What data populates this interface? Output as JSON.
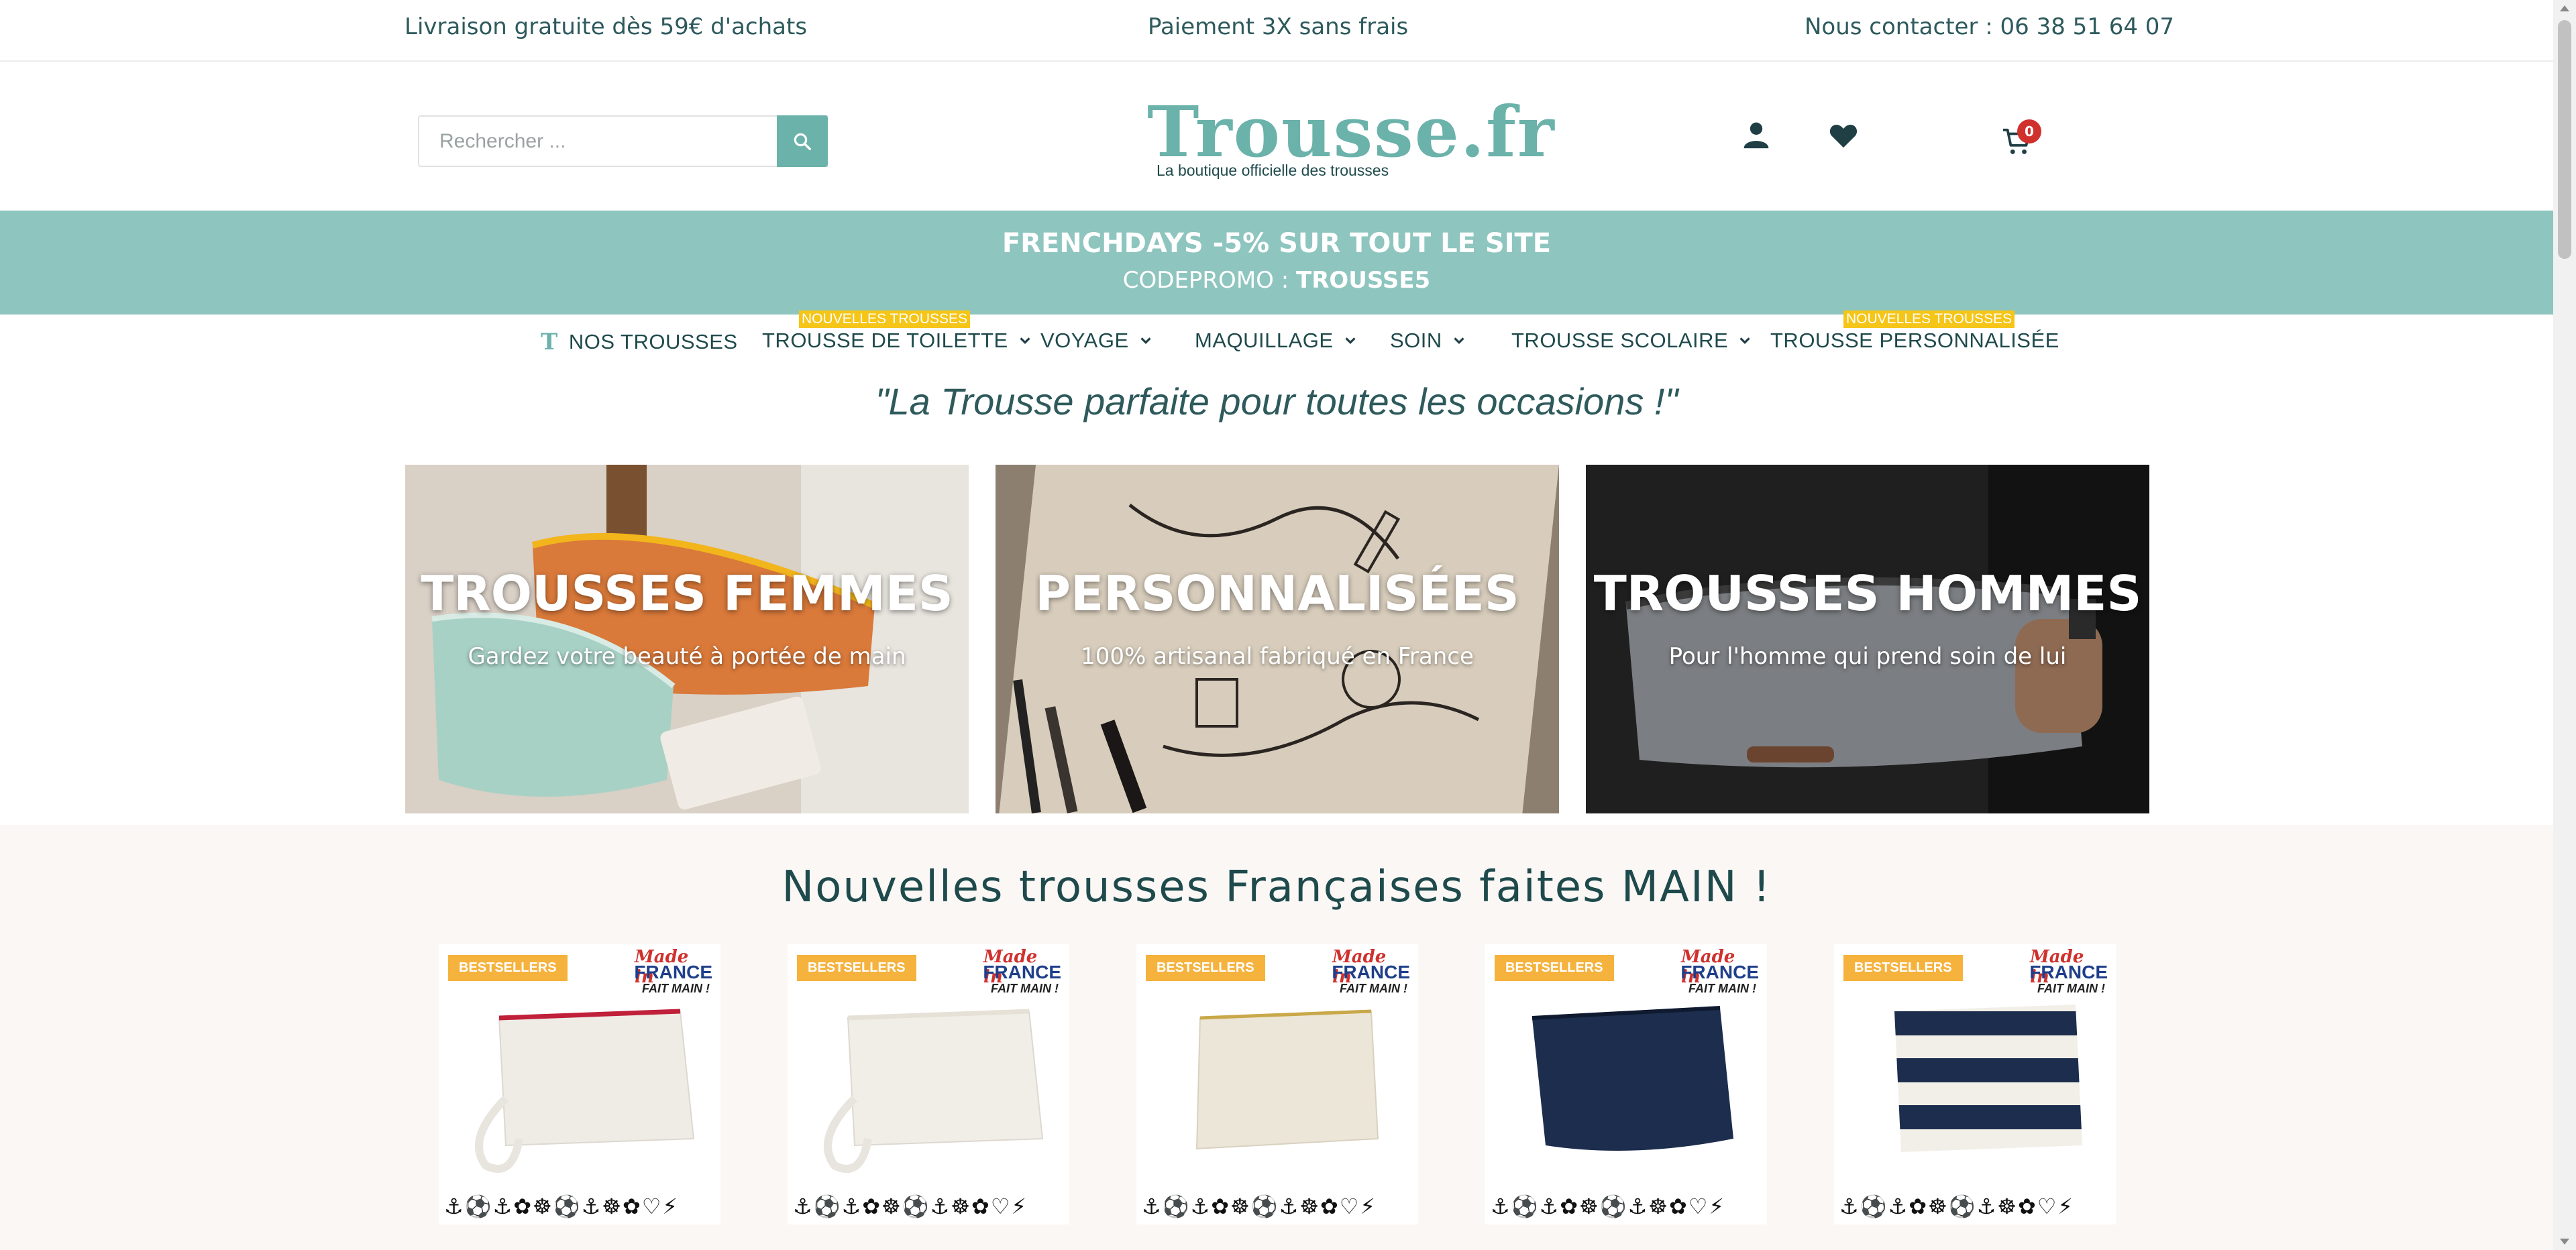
{
  "topbar": {
    "shipping": "Livraison gratuite dès 59€ d'achats",
    "payment": "Paiement 3X sans frais",
    "contact": "Nous contacter : 06 38 51 64 07"
  },
  "header": {
    "search_placeholder": "Rechercher ...",
    "logo_text": "Trousse.fr",
    "logo_tagline": "La boutique officielle des trousses",
    "cart_count": "0",
    "icons": [
      "search-icon",
      "user-icon",
      "heart-icon",
      "cart-icon"
    ]
  },
  "promo": {
    "line1": "FRENCHDAYS -5% SUR TOUT LE SITE",
    "line2_prefix": "CODEPROMO : ",
    "line2_code": "TROUSSE5"
  },
  "nav": {
    "items": [
      {
        "label": "NOS TROUSSES"
      },
      {
        "label": "TROUSSE DE TOILETTE",
        "badge": "NOUVELLES TROUSSES"
      },
      {
        "label": "VOYAGE"
      },
      {
        "label": "MAQUILLAGE"
      },
      {
        "label": "SOIN"
      },
      {
        "label": "TROUSSE SCOLAIRE"
      },
      {
        "label": "TROUSSE PERSONNALISÉE",
        "badge": "NOUVELLES TROUSSES"
      }
    ]
  },
  "tagline": "\"La Trousse parfaite pour toutes les occasions !\"",
  "categories": [
    {
      "title": "TROUSSES FEMMES",
      "subtitle": "Gardez votre beauté à portée de main"
    },
    {
      "title": "PERSONNALISÉES",
      "subtitle": "100% artisanal fabriqué en France"
    },
    {
      "title": "TROUSSES HOMMES",
      "subtitle": "Pour l'homme qui prend soin de lui"
    }
  ],
  "products_section": {
    "title": "Nouvelles trousses Françaises faites MAIN !",
    "badge": "BESTSELLERS",
    "made_in_1": "Made in",
    "made_in_2": "FRANCE",
    "made_in_3": "FAIT MAIN !",
    "motif_row": "⚓⚽⚓✿☸⚽⚓☸✿♡⚡",
    "colors": {
      "accent": "#6ab2aa",
      "promo_bg": "#8ec5bf",
      "badge_yellow": "#f5c518",
      "bestseller": "#f5b23d",
      "navy": "#1d2d4e"
    }
  }
}
